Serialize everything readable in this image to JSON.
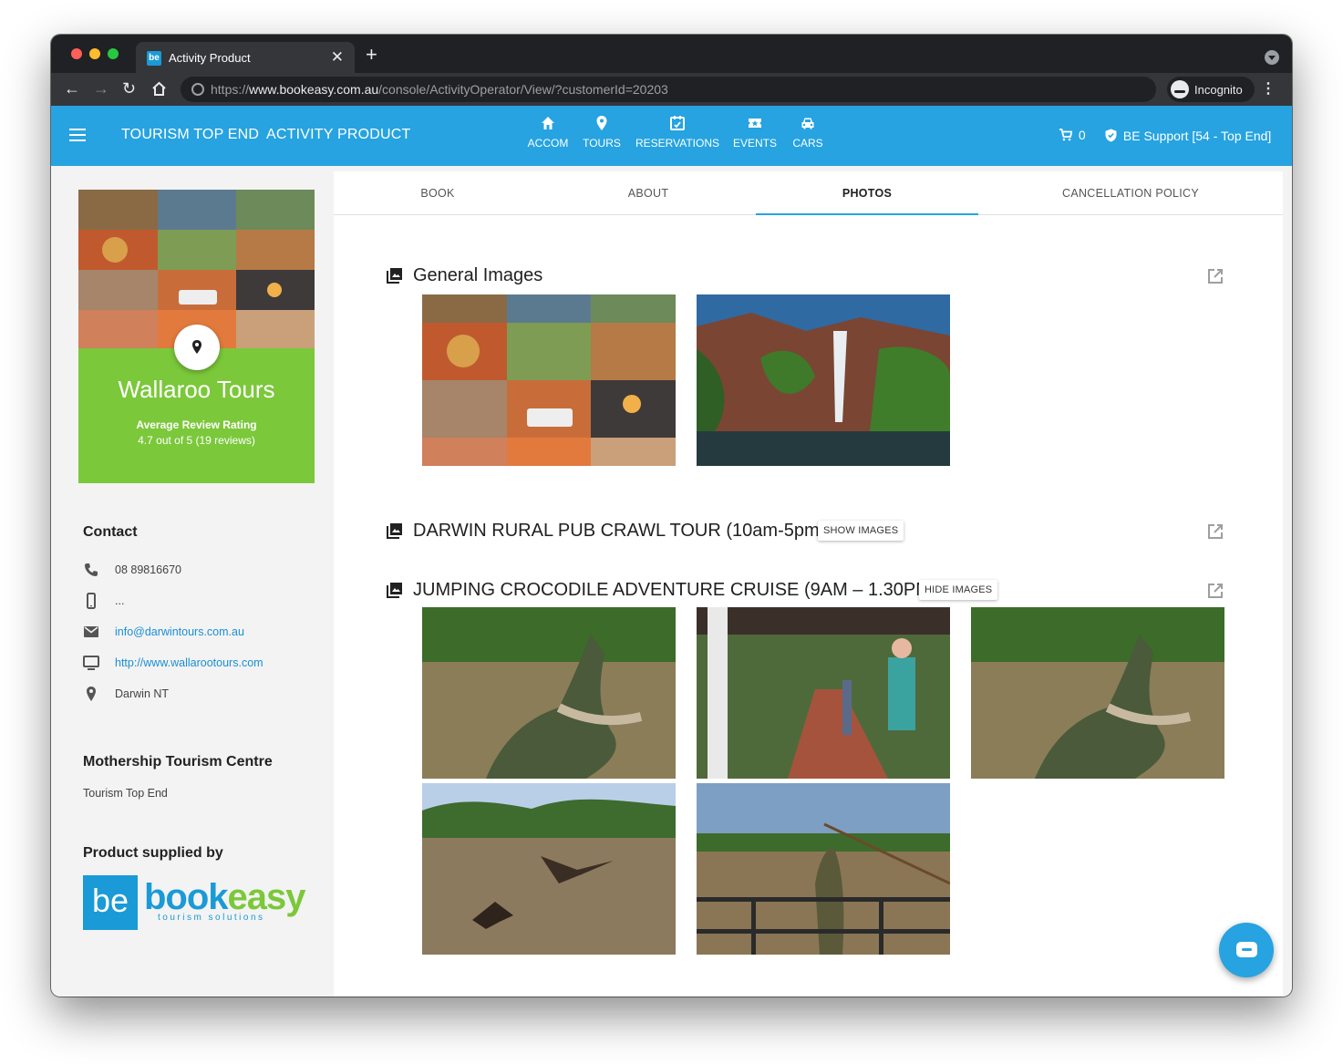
{
  "browser": {
    "tab_title": "Activity Product",
    "tab_close": "✕",
    "new_tab": "+",
    "url_prefix": "https://",
    "url_host": "www.bookeasy.com.au",
    "url_path": "/console/ActivityOperator/View/?customerId=20203",
    "incognito_label": "Incognito",
    "menu": "⋮"
  },
  "header": {
    "brand_1": "TOURISM TOP END",
    "brand_2": "ACTIVITY PRODUCT",
    "nav": [
      {
        "label": "ACCOM",
        "icon": "home-icon"
      },
      {
        "label": "TOURS",
        "icon": "pin-icon"
      },
      {
        "label": "RESERVATIONS",
        "icon": "calendar-icon"
      },
      {
        "label": "EVENTS",
        "icon": "ticket-icon"
      },
      {
        "label": "CARS",
        "icon": "car-icon"
      }
    ],
    "cart_count": "0",
    "support_label": "BE Support [54 - Top End]"
  },
  "sidebar": {
    "operator_name": "Wallaroo Tours",
    "rating_title": "Average Review Rating",
    "rating_text": "4.7 out of 5 (19 reviews)",
    "contact_title": "Contact",
    "phone": "08 89816670",
    "mobile": "...",
    "email": "info@darwintours.com.au",
    "website": "http://www.wallarootours.com",
    "location": "Darwin NT",
    "mothership_title": "Mothership Tourism Centre",
    "mothership_value": "Tourism Top End",
    "supplied_title": "Product supplied by",
    "logo_text": "bookeasy",
    "logo_badge": "be",
    "logo_sub": "tourism solutions"
  },
  "tabs": [
    "BOOK",
    "ABOUT",
    "PHOTOS",
    "CANCELLATION POLICY"
  ],
  "active_tab": "PHOTOS",
  "galleries": [
    {
      "title": "General Images",
      "button": ""
    },
    {
      "title": "DARWIN RURAL PUB CRAWL TOUR (10am-5pm)",
      "button": "SHOW IMAGES"
    },
    {
      "title": "JUMPING CROCODILE ADVENTURE CRUISE (9AM – 1.30PM)",
      "button": "HIDE IMAGES"
    }
  ],
  "colors": {
    "accent": "#26a3e0",
    "green": "#7bc83b",
    "link": "#1a8fd6"
  }
}
